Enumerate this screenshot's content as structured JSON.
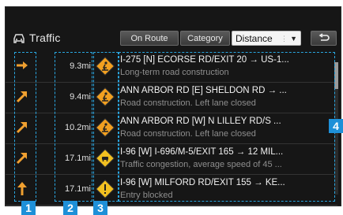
{
  "header": {
    "title": "Traffic",
    "on_route_label": "On Route",
    "category_label": "Category",
    "sort_value": "Distance",
    "back_icon": "back-arrow-icon"
  },
  "callouts": {
    "c1": "1",
    "c2": "2",
    "c3": "3",
    "c4": "4"
  },
  "incidents": [
    {
      "direction_icon": "arrow-right",
      "distance": "9.3mi",
      "sign_icon": "roadwork-sign-icon",
      "road": "I-275 [N] ECORSE RD/EXIT 20 → US-1...",
      "desc": "Long-term road construction"
    },
    {
      "direction_icon": "arrow-up-right",
      "distance": "9.4mi",
      "sign_icon": "roadwork-sign-icon",
      "road": "ANN ARBOR RD [E] SHELDON RD → ...",
      "desc": "Road construction. Left lane closed"
    },
    {
      "direction_icon": "arrow-up-right",
      "distance": "10.2mi",
      "sign_icon": "roadwork-sign-icon",
      "road": "ANN ARBOR RD [W] N LILLEY RD/S ...",
      "desc": "Road construction. Left lane closed"
    },
    {
      "direction_icon": "arrow-up-right",
      "distance": "17.1mi",
      "sign_icon": "congestion-sign-icon",
      "road": "I-96 [W] I-696/M-5/EXIT 165 → 12 MIL...",
      "desc": "Traffic congestion, average speed of 45 ..."
    },
    {
      "direction_icon": "arrow-up",
      "distance": "17.1mi",
      "sign_icon": "warning-sign-icon",
      "road": "I-96 [W] MILFORD RD/EXIT 155 → KE...",
      "desc": "Entry blocked"
    }
  ]
}
